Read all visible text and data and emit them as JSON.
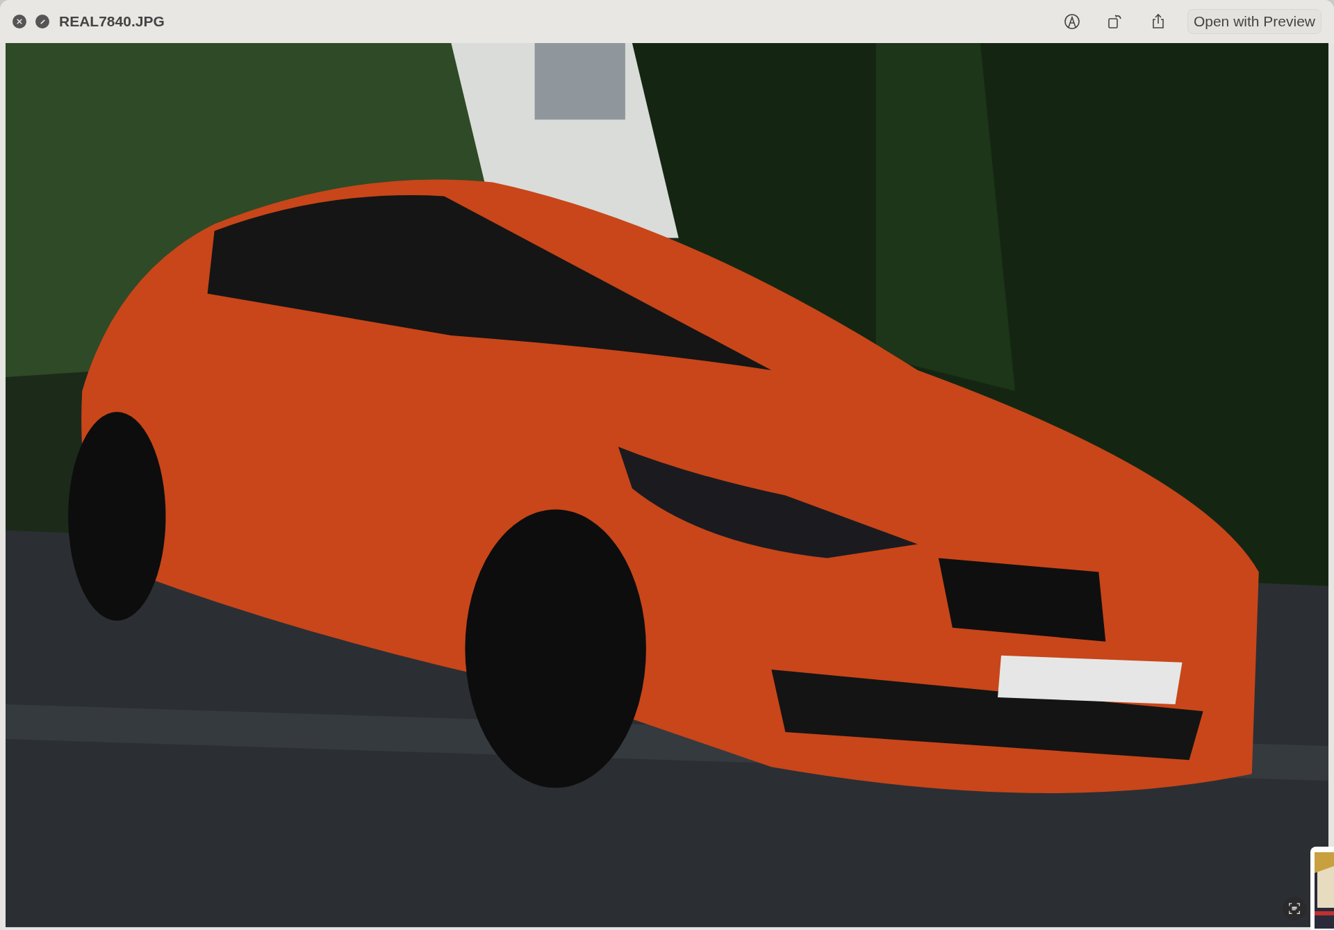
{
  "window": {
    "title": "REAL7840.JPG"
  },
  "toolbar": {
    "open_button": "Open with Preview"
  }
}
